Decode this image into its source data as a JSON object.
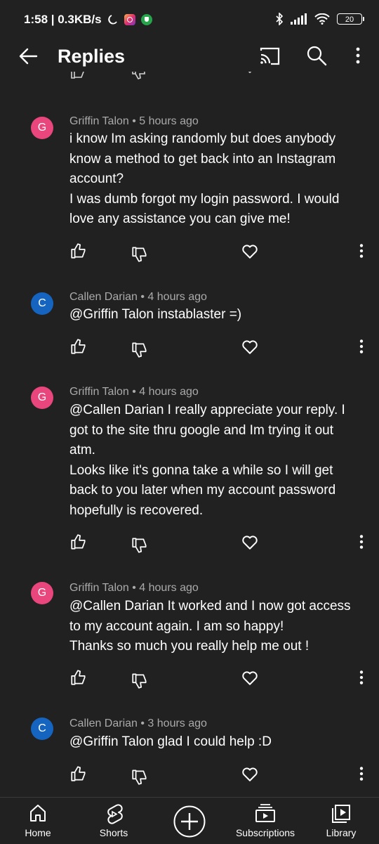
{
  "status_bar": {
    "time_speed": "1:58 | 0.3KB/s",
    "battery": "20"
  },
  "app_bar": {
    "title": "Replies"
  },
  "comments": [
    {
      "avatar_letter": "G",
      "avatar_color": "#e8467c",
      "meta": "Griffin Talon • 5 hours ago",
      "lines": [
        "i know Im asking randomly but does anybody",
        "know a method to get back into an Instagram",
        "account?",
        "I was dumb forgot my login password. I would",
        "love any assistance you can give me!"
      ]
    },
    {
      "avatar_letter": "C",
      "avatar_color": "#1565c0",
      "meta": "Callen Darian • 4 hours ago",
      "lines": [
        "@Griffin Talon instablaster =)"
      ]
    },
    {
      "avatar_letter": "G",
      "avatar_color": "#e8467c",
      "meta": "Griffin Talon • 4 hours ago",
      "lines": [
        "@Callen Darian I really appreciate your reply. I",
        "got to the site thru google and Im trying it out",
        "atm.",
        "Looks like it's gonna take a while so I will get",
        "back to you later when my account password",
        "hopefully is recovered."
      ]
    },
    {
      "avatar_letter": "G",
      "avatar_color": "#e8467c",
      "meta": "Griffin Talon • 4 hours ago",
      "lines": [
        "@Callen Darian It worked and I now got access",
        "to my account again. I am so happy!",
        "Thanks so much you really help me out !"
      ]
    },
    {
      "avatar_letter": "C",
      "avatar_color": "#1565c0",
      "meta": "Callen Darian • 3 hours ago",
      "lines": [
        "@Griffin Talon glad I could help :D"
      ]
    }
  ],
  "bottom_nav": {
    "home": "Home",
    "shorts": "Shorts",
    "subscriptions": "Subscriptions",
    "library": "Library"
  },
  "icons": {
    "back": "arrow-left-icon",
    "cast": "cast-icon",
    "search": "search-icon",
    "more": "more-vert-icon",
    "like": "thumbs-up-icon",
    "dislike": "thumbs-down-icon",
    "heart": "heart-icon",
    "create": "plus-circle-icon"
  }
}
